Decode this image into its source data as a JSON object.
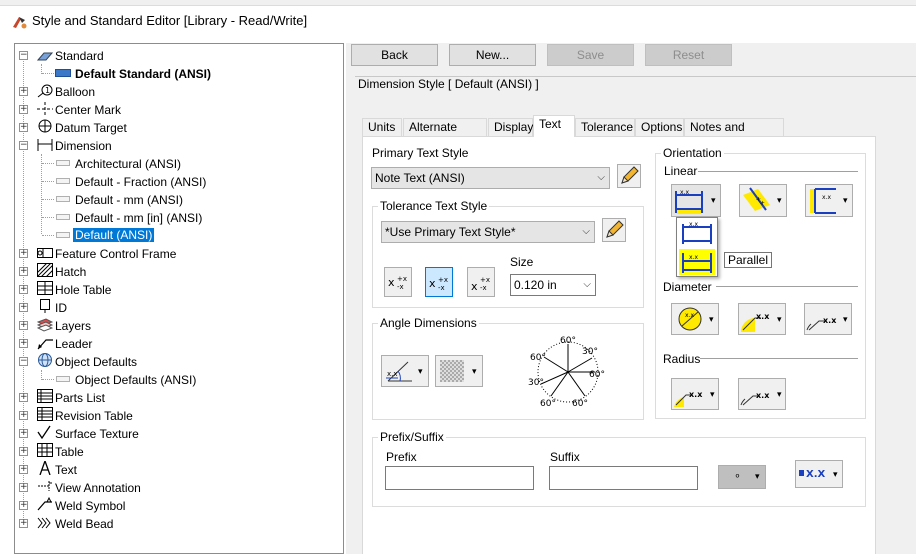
{
  "window": {
    "title": "Style and Standard Editor [Library - Read/Write]"
  },
  "tree": {
    "standard": "Standard",
    "default_standard": "Default Standard (ANSI)",
    "balloon": "Balloon",
    "center_mark": "Center Mark",
    "datum_target": "Datum Target",
    "dimension": "Dimension",
    "dim_children": [
      "Architectural (ANSI)",
      "Default - Fraction (ANSI)",
      "Default - mm (ANSI)",
      "Default - mm [in] (ANSI)",
      "Default (ANSI)"
    ],
    "feature_control_frame": "Feature Control Frame",
    "hatch": "Hatch",
    "hole_table": "Hole Table",
    "id": "ID",
    "layers": "Layers",
    "leader": "Leader",
    "object_defaults": "Object Defaults",
    "object_defaults_child": "Object Defaults (ANSI)",
    "parts_list": "Parts List",
    "revision_table": "Revision Table",
    "surface_texture": "Surface Texture",
    "table": "Table",
    "text": "Text",
    "view_annotation": "View Annotation",
    "weld_symbol": "Weld Symbol",
    "weld_bead": "Weld Bead"
  },
  "toolbar": {
    "back": "Back",
    "new": "New...",
    "save": "Save",
    "reset": "Reset"
  },
  "style_header": "Dimension Style [ Default (ANSI) ]",
  "tabs": [
    "Units",
    "Alternate Units",
    "Display",
    "Text",
    "Tolerance",
    "Options",
    "Notes and Leaders"
  ],
  "active_tab": "Text",
  "text_tab": {
    "primary_text_style_label": "Primary Text Style",
    "primary_text_style_value": "Note Text (ANSI)",
    "tolerance_text_style_label": "Tolerance Text Style",
    "tolerance_text_style_value": "*Use Primary Text Style*",
    "size_label": "Size",
    "size_value": "0.120 in",
    "angle_dimensions_label": "Angle Dimensions",
    "angle_labels": [
      "60°",
      "30°",
      "60°",
      "30°",
      "60°",
      "60°"
    ],
    "prefix_suffix_label": "Prefix/Suffix",
    "prefix_label": "Prefix",
    "suffix_label": "Suffix",
    "prefix_value": "",
    "suffix_value": "",
    "symbol_dropdown": "∘",
    "orientation_label": "Orientation",
    "linear_label": "Linear",
    "diameter_label": "Diameter",
    "radius_label": "Radius",
    "tooltip": "Parallel",
    "icon_text": "x.x",
    "icon_text_box": "X.X",
    "tol_icon_text": "x",
    "linear_icon_text": "x.x"
  },
  "colors": {
    "selection": "#0078d7",
    "highlight_yellow": "#ffff00",
    "icon_blue": "#1a3fbf"
  }
}
